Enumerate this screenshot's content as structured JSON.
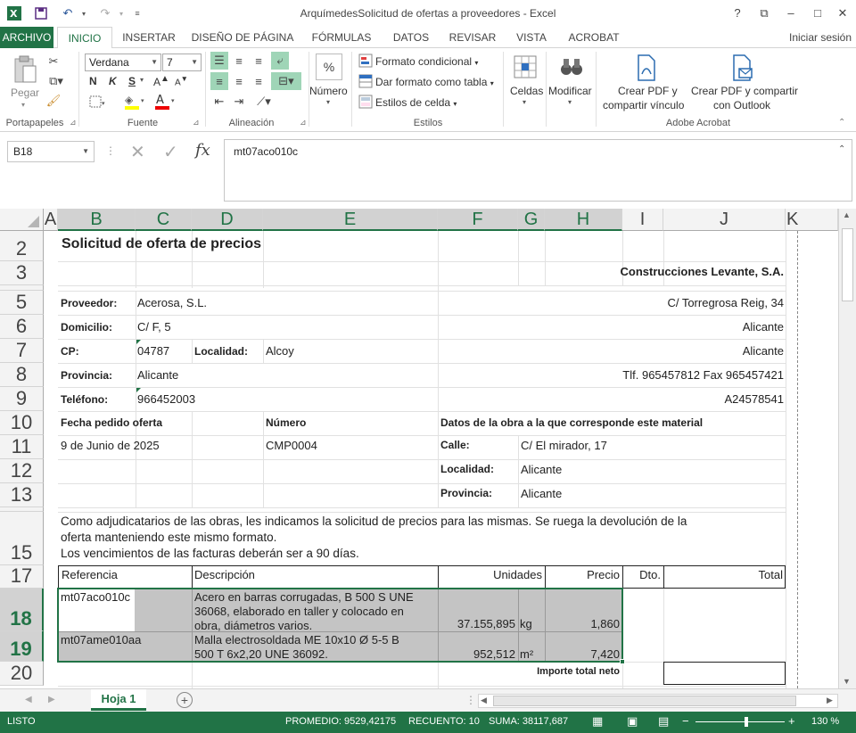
{
  "window": {
    "title": "ArquímedesSolicitud de ofertas a proveedores - Excel",
    "help": "?",
    "signin": "Iniciar sesión"
  },
  "tabs": [
    "ARCHIVO",
    "INICIO",
    "INSERTAR",
    "DISEÑO DE PÁGINA",
    "FÓRMULAS",
    "DATOS",
    "REVISAR",
    "VISTA",
    "ACROBAT"
  ],
  "ribbon": {
    "paste_label": "Pegar",
    "font_name": "Verdana",
    "font_size": "7",
    "bold": "N",
    "italic": "K",
    "underline": "S",
    "number_label": "Número",
    "percent": "%",
    "cond_format": "Formato condicional",
    "format_table": "Dar formato como tabla",
    "cell_styles": "Estilos de celda",
    "cells_label": "Celdas",
    "modify_label": "Modificar",
    "pdf_share_l1": "Crear PDF y",
    "pdf_share_l2": "compartir vínculo",
    "pdf_outlook_l1": "Crear PDF y compartir",
    "pdf_outlook_l2": "con Outlook",
    "groups": {
      "clipboard": "Portapapeles",
      "font": "Fuente",
      "alignment": "Alineación",
      "styles": "Estilos",
      "acrobat": "Adobe Acrobat"
    }
  },
  "formula_bar": {
    "name_box": "B18",
    "fx": "fx",
    "content": "mt07aco010c"
  },
  "columns": [
    "A",
    "B",
    "C",
    "D",
    "E",
    "F",
    "G",
    "H",
    "I",
    "J",
    "K"
  ],
  "rows": [
    "2",
    "3",
    "5",
    "6",
    "7",
    "8",
    "9",
    "10",
    "11",
    "12",
    "13",
    "15",
    "17",
    "18",
    "19",
    "20"
  ],
  "sheet": {
    "title": "Solicitud de oferta de precios",
    "company": "Construcciones Levante, S.A.",
    "proveedor_label": "Proveedor:",
    "proveedor": "Acerosa, S.L.",
    "company_address": "C/ Torregrosa Reig, 34",
    "domicilio_label": "Domicilio:",
    "domicilio": "C/ F, 5",
    "company_city1": "Alicante",
    "cp_label": "CP:",
    "cp": "04787",
    "localidad_label": "Localidad:",
    "localidad": "Alcoy",
    "company_city2": "Alicante",
    "provincia_label": "Provincia:",
    "provincia": "Alicante",
    "company_phone": "Tlf. 965457812 Fax 965457421",
    "telefono_label": "Teléfono:",
    "telefono": "966452003",
    "company_cif": "A24578541",
    "fecha_label": "Fecha pedido oferta",
    "numero_label": "Número",
    "obra_label": "Datos de la obra a la que corresponde este material",
    "fecha": "9 de Junio de 2025",
    "numero": "CMP0004",
    "calle_label": "Calle:",
    "calle": "C/ El mirador, 17",
    "obra_localidad_label": "Localidad:",
    "obra_localidad": "Alicante",
    "obra_provincia_label": "Provincia:",
    "obra_provincia": "Alicante",
    "note_line1": "Como adjudicatarios de las obras, les indicamos la solicitud de precios para las mismas. Se ruega la devolución de la",
    "note_line2": "oferta manteniendo este mismo formato.",
    "note_line3": "Los vencimientos de las facturas deberán ser a 90 días.",
    "headers": {
      "ref": "Referencia",
      "desc": "Descripción",
      "units": "Unidades",
      "price": "Precio",
      "dto": "Dto.",
      "total": "Total"
    },
    "items": [
      {
        "ref": "mt07aco010c",
        "desc1": "Acero en barras corrugadas, B 500 S UNE",
        "desc2": "36068, elaborado en taller y colocado en",
        "desc3": "obra, diámetros varios.",
        "units": "37.155,895",
        "unit": "kg",
        "price": "1,860"
      },
      {
        "ref": "mt07ame010aa",
        "desc1": "Malla electrosoldada ME 10x10 Ø 5-5 B",
        "desc2": "500 T 6x2,20 UNE 36092.",
        "units": "952,512",
        "unit": "m²",
        "price": "7,420"
      }
    ],
    "total_label": "Importe total neto"
  },
  "sheet_tab": "Hoja 1",
  "status": {
    "mode": "LISTO",
    "average": "PROMEDIO: 9529,42175",
    "count": "RECUENTO: 10",
    "sum": "SUMA: 38117,687",
    "zoom": "130 %"
  }
}
